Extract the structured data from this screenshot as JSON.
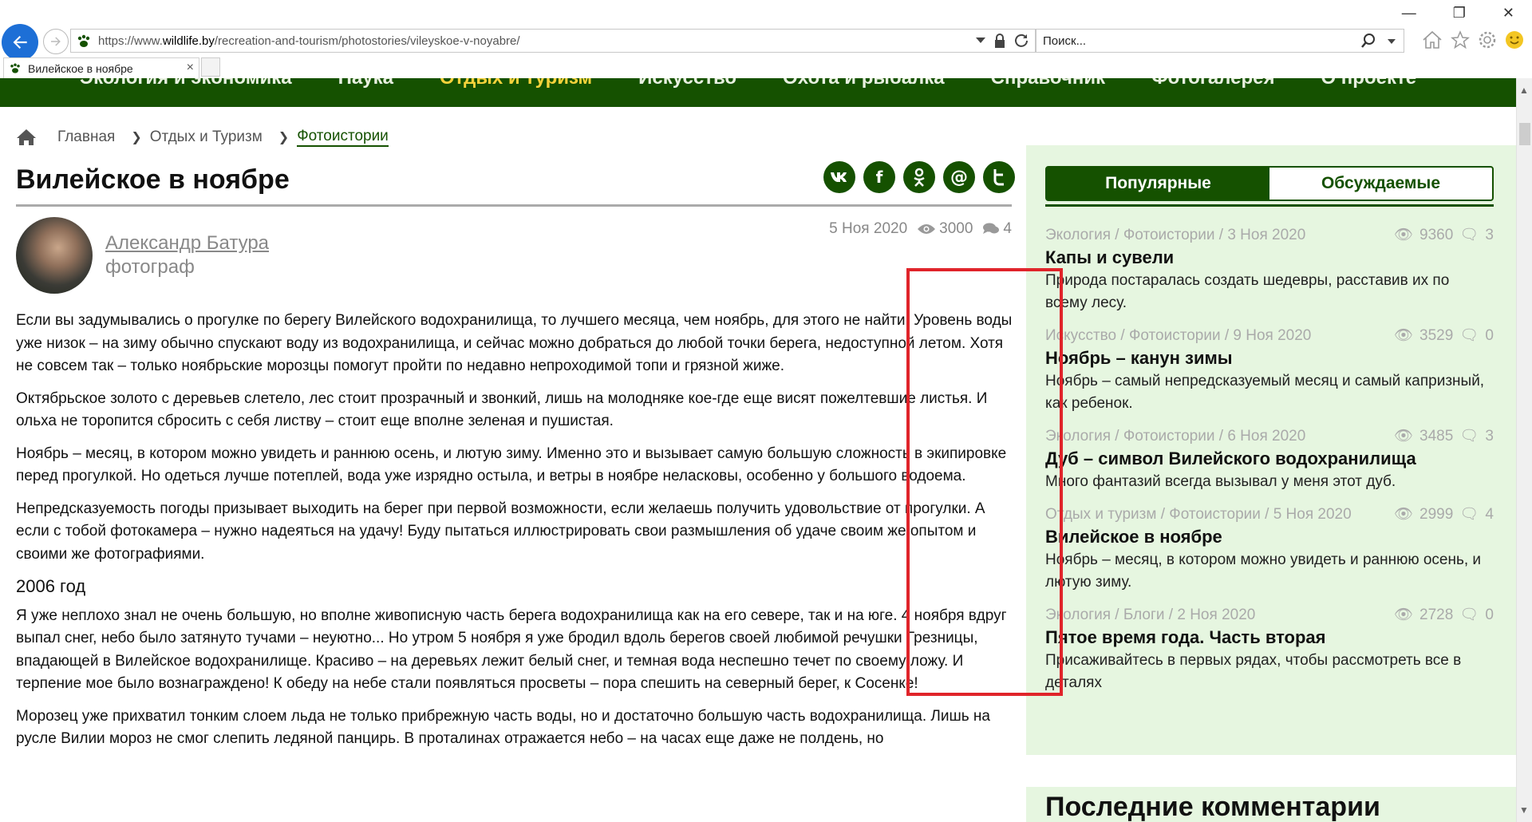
{
  "browser": {
    "url_prefix": "https://www.",
    "url_host": "wildlife.by",
    "url_path": "/recreation-and-tourism/photostories/vileyskoe-v-noyabre/",
    "search_placeholder": "Поиск...",
    "tab_title": "Вилейское в ноябре",
    "tab_close": "×"
  },
  "site_nav": {
    "items": [
      "Экология и экономика",
      "Наука",
      "Отдых и туризм",
      "Искусство",
      "Охота и рыбалка",
      "Справочник",
      "Фотогалерея",
      "О проекте"
    ],
    "active_index": 2
  },
  "breadcrumb": {
    "home": "Главная",
    "section": "Отдых и Туризм",
    "current": "Фотоистории"
  },
  "article": {
    "title": "Вилейское в ноябре",
    "author_name": "Александр Батура",
    "author_role": "фотограф",
    "date": "5 Ноя 2020",
    "views": "3000",
    "comments": "4",
    "paragraphs": [
      "Если вы задумывались о прогулке по берегу Вилейского водохранилища, то лучшего месяца, чем ноябрь, для этого не найти. Уровень воды уже низок – на зиму обычно спускают воду из водохранилища, и сейчас можно добраться до любой точки берега, недоступной летом. Хотя не совсем так – только ноябрьские морозцы помогут пройти по недавно непроходимой топи и грязной жиже.",
      "Октябрьское золото с деревьев слетело, лес стоит прозрачный и звонкий, лишь на молодняке кое-где еще висят пожелтевшие листья. И ольха не торопится сбросить с себя листву – стоит еще вполне зеленая и пушистая.",
      "Ноябрь – месяц, в котором можно увидеть и раннюю осень, и лютую зиму. Именно это и вызывает самую большую сложность в экипировке перед прогулкой. Но одеться лучше потеплей, вода уже изрядно остыла, и ветры в ноябре неласковы, особенно у большого водоема.",
      "Непредсказуемость погоды призывает выходить на берег при первой возможности, если желаешь получить удовольствие от прогулки. А если с тобой фотокамера – нужно надеяться на удачу! Буду пытаться иллюстрировать свои размышления об удаче своим же опытом и своими же фотографиями."
    ],
    "subheading": "2006 год",
    "paragraphs_2": [
      "Я уже неплохо знал не очень большую, но вполне живописную часть берега водохранилища как на его севере, так и на юге. 4 ноября вдруг выпал снег, небо было затянуто тучами – неуютно... Но утром 5 ноября я уже бродил вдоль берегов своей любимой речушки Грезницы, впадающей в Вилейское водохранилище. Красиво – на деревьях лежит белый снег, и темная вода неспешно течет по своему ложу. И терпение мое было вознаграждено! К обеду на небе стали появляться просветы – пора спешить на северный берег, к Сосенке!",
      "Морозец уже прихватил тонким слоем льда не только прибрежную часть воды, но и достаточно большую часть водохранилища. Лишь на русле Вилии мороз не смог слепить ледяной панцирь. В проталинах отражается небо – на часах еще даже не полдень, но"
    ]
  },
  "sidebar": {
    "tab_popular": "Популярные",
    "tab_discussed": "Обсуждаемые",
    "items": [
      {
        "meta": "Экология / Фотоистории / 3 Ноя 2020",
        "views": "9360",
        "comments": "3",
        "title": "Капы и сувели",
        "desc": "Природа постаралась создать шедевры, расставив их по всему лесу."
      },
      {
        "meta": "Искусство / Фотоистории / 9 Ноя 2020",
        "views": "3529",
        "comments": "0",
        "title": "Ноябрь – канун зимы",
        "desc": "Ноябрь – самый непредсказуемый месяц и самый капризный, как ребенок."
      },
      {
        "meta": "Экология / Фотоистории / 6 Ноя 2020",
        "views": "3485",
        "comments": "3",
        "title": "Дуб – символ Вилейского водохранилища",
        "desc": "Много фантазий всегда вызывал у меня этот дуб."
      },
      {
        "meta": "Отдых и туризм / Фотоистории / 5 Ноя 2020",
        "views": "2999",
        "comments": "4",
        "title": "Вилейское в ноябре",
        "desc": "Ноябрь – месяц, в котором можно увидеть и раннюю осень, и лютую зиму."
      },
      {
        "meta": "Экология / Блоги / 2 Ноя 2020",
        "views": "2728",
        "comments": "0",
        "title": "Пятое время года. Часть вторая",
        "desc": "Присаживайтесь в первых рядах, чтобы рассмотреть все в деталях"
      }
    ],
    "comments_heading": "Последние комментарии"
  },
  "colors": {
    "site_green": "#155100",
    "sidebar_bg": "#e6f6e0",
    "nav_active": "#f5d23b",
    "annotation_red": "#e0242a"
  }
}
